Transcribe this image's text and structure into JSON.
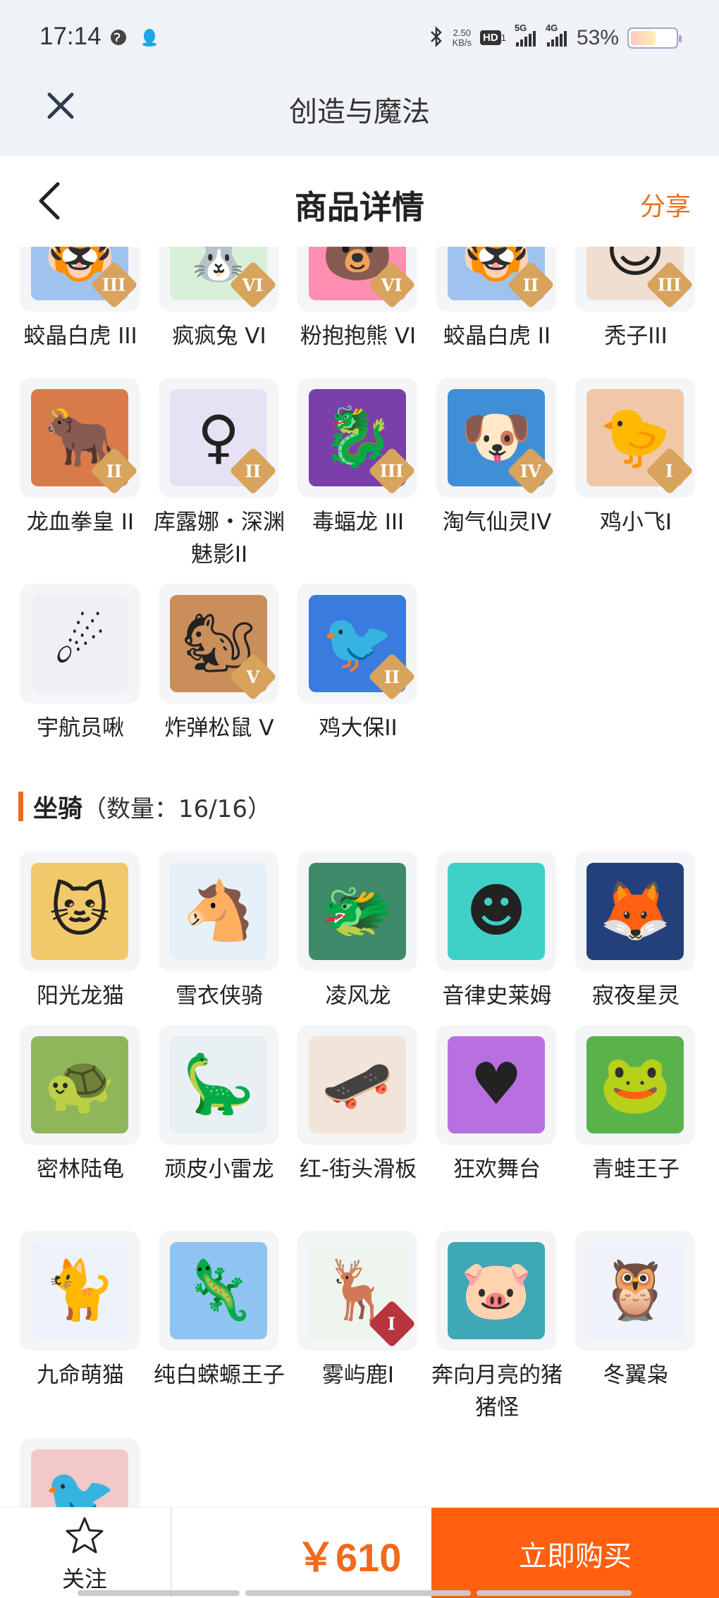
{
  "status_bar": {
    "time": "17:14",
    "net_speed_value": "2.50",
    "net_speed_unit": "KB/s",
    "hd": "HD",
    "hd_sub": "1",
    "sig1_tag": "5G",
    "sig2_tag": "4G",
    "battery": "53%",
    "battery_level": 0.53
  },
  "app_bar": {
    "title": "创造与魔法"
  },
  "header": {
    "title": "商品详情",
    "share": "分享"
  },
  "pets_partial": [
    {
      "name": "蛟晶白虎 III",
      "icon": "tiger-icon",
      "badge": "III",
      "bg": "#9fc3ee",
      "badge_color": "#d8a35c"
    },
    {
      "name": "疯疯兔 VI",
      "icon": "rabbit-icon",
      "badge": "VI",
      "bg": "#d8f0d8",
      "badge_color": "#d8a35c"
    },
    {
      "name": "粉抱抱熊 VI",
      "icon": "bear-icon",
      "badge": "VI",
      "bg": "#ff8fb2",
      "badge_color": "#d8a35c"
    },
    {
      "name": "蛟晶白虎 II",
      "icon": "tiger-icon",
      "badge": "II",
      "bg": "#9fc3ee",
      "badge_color": "#d8a35c"
    },
    {
      "name": "秃子III",
      "icon": "bald-doll-icon",
      "badge": "III",
      "bg": "#f0ded0",
      "badge_color": "#d8a35c"
    }
  ],
  "pets_row2": [
    {
      "name": "龙血拳皇 II",
      "icon": "beast-icon",
      "badge": "II",
      "bg": "#d97a4a",
      "badge_color": "#d8a35c"
    },
    {
      "name": "库露娜・深渊魅影II",
      "icon": "ghost-girl-icon",
      "badge": "II",
      "bg": "#e6e2f4",
      "badge_color": "#d8a35c"
    },
    {
      "name": "毒蝠龙 III",
      "icon": "bat-dragon-icon",
      "badge": "III",
      "bg": "#7a3fa8",
      "badge_color": "#d8a35c"
    },
    {
      "name": "淘气仙灵IV",
      "icon": "puppy-icon",
      "badge": "IV",
      "bg": "#3f8fd6",
      "badge_color": "#d8a35c"
    },
    {
      "name": "鸡小飞I",
      "icon": "chick-icon",
      "badge": "I",
      "bg": "#f0c8a8",
      "badge_color": "#d8a35c"
    }
  ],
  "pets_row3": [
    {
      "name": "宇航员啾",
      "icon": "astronaut-icon",
      "badge": "",
      "bg": "#eef0f6",
      "badge_color": "#d8a35c"
    },
    {
      "name": "炸弹松鼠 V",
      "icon": "squirrel-icon",
      "badge": "V",
      "bg": "#c98e5a",
      "badge_color": "#d8a35c"
    },
    {
      "name": "鸡大保II",
      "icon": "blue-bird-icon",
      "badge": "II",
      "bg": "#3a7be0",
      "badge_color": "#d8a35c"
    }
  ],
  "mounts_section": {
    "title": "坐骑",
    "count": "（数量：16/16）"
  },
  "mounts_row1": [
    {
      "name": "阳光龙猫",
      "icon": "totoro-icon",
      "badge": "",
      "bg": "#f2c96a",
      "badge_color": ""
    },
    {
      "name": "雪衣侠骑",
      "icon": "white-horse-icon",
      "badge": "",
      "bg": "#e6f0f8",
      "badge_color": ""
    },
    {
      "name": "凌风龙",
      "icon": "green-dragon-icon",
      "badge": "",
      "bg": "#3f8a6a",
      "badge_color": ""
    },
    {
      "name": "音律史莱姆",
      "icon": "slime-icon",
      "badge": "",
      "bg": "#3fd0c8",
      "badge_color": ""
    },
    {
      "name": "寂夜星灵",
      "icon": "night-fox-icon",
      "badge": "",
      "bg": "#24407a",
      "badge_color": ""
    }
  ],
  "mounts_row2": [
    {
      "name": "密林陆龟",
      "icon": "turtle-icon",
      "badge": "",
      "bg": "#8fb65a",
      "badge_color": ""
    },
    {
      "name": "顽皮小雷龙",
      "icon": "sauropod-icon",
      "badge": "",
      "bg": "#e8f0f4",
      "badge_color": ""
    },
    {
      "name": "红-街头滑板",
      "icon": "skateboard-icon",
      "badge": "",
      "bg": "#f2e4d8",
      "badge_color": ""
    },
    {
      "name": "狂欢舞台",
      "icon": "stage-icon",
      "badge": "",
      "bg": "#b870e0",
      "badge_color": ""
    },
    {
      "name": "青蛙王子",
      "icon": "frog-prince-icon",
      "badge": "",
      "bg": "#5ab24a",
      "badge_color": ""
    }
  ],
  "mounts_row3": [
    {
      "name": "九命萌猫",
      "icon": "white-cat-icon",
      "badge": "",
      "bg": "#eef2fb",
      "badge_color": ""
    },
    {
      "name": "纯白蝾螈王子",
      "icon": "axolotl-icon",
      "badge": "",
      "bg": "#8fc4f0",
      "badge_color": ""
    },
    {
      "name": "雾屿鹿I",
      "icon": "deer-icon",
      "badge": "I",
      "bg": "#eef4ee",
      "badge_color": "#b8343f"
    },
    {
      "name": "奔向月亮的猪猪怪",
      "icon": "pig-icon",
      "badge": "",
      "bg": "#3fa8b6",
      "badge_color": ""
    },
    {
      "name": "冬翼枭",
      "icon": "owl-icon",
      "badge": "",
      "bg": "#f0f2fa",
      "badge_color": ""
    }
  ],
  "mounts_row4": [
    {
      "name": "",
      "icon": "phoenix-icon",
      "badge": "",
      "bg": "#f2c8c8",
      "badge_color": ""
    }
  ],
  "bottom_bar": {
    "follow_label": "关注",
    "price": "￥610",
    "buy_label": "立即购买"
  },
  "colors": {
    "accent": "#ff5f0f",
    "price": "#f06a1b",
    "share": "#e8711a"
  }
}
